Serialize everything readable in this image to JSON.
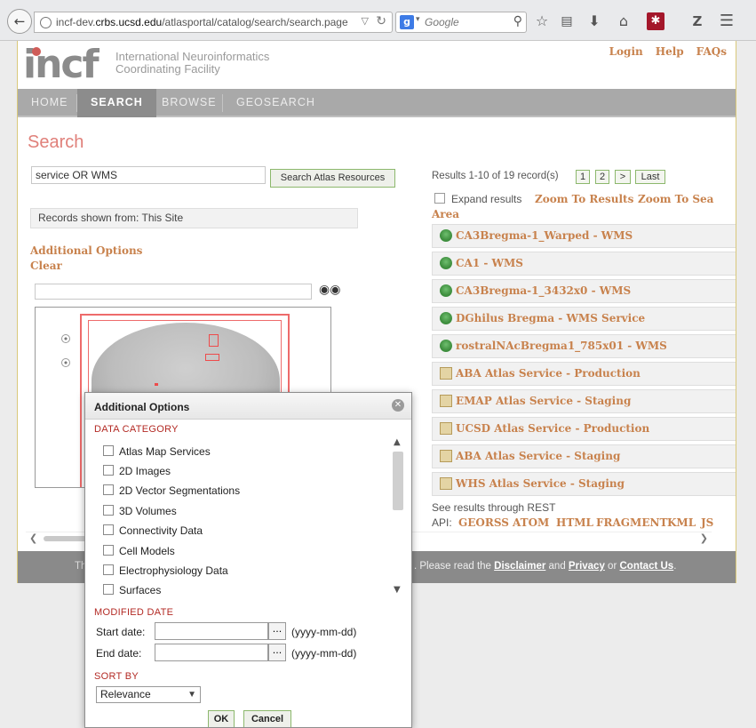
{
  "browser": {
    "url_prefix": "incf-dev.",
    "url_domain": "crbs.ucsd.edu",
    "url_path": "/atlasportal/catalog/search/search.page",
    "search_engine_letter": "g",
    "search_placeholder": "Google"
  },
  "header": {
    "logo_mark": "incf",
    "logo_line1": "International Neuroinformatics",
    "logo_line2": "Coordinating Facility",
    "links": [
      "Login",
      "Help",
      "FAQs"
    ]
  },
  "nav": {
    "items": [
      "HOME",
      "SEARCH",
      "BROWSE",
      "GEOSEARCH"
    ],
    "active": "SEARCH"
  },
  "main": {
    "title": "Search",
    "search_value": "service OR WMS",
    "search_button": "Search Atlas Resources",
    "records_from": "Records shown from: This Site",
    "additional_options": "Additional Options",
    "clear": "Clear"
  },
  "results": {
    "count_text": "Results 1-10 of 19 record(s)",
    "pages": [
      "1",
      "2",
      ">",
      "Last"
    ],
    "expand_label": "Expand results",
    "zoom_to_results": "Zoom To Results",
    "zoom_to_search": "Zoom To Sea",
    "area": "Area",
    "items": [
      {
        "label": "CA3Bregma-1_Warped - WMS",
        "icon": "wms-globe-icon"
      },
      {
        "label": "CA1 - WMS",
        "icon": "wms-globe-icon"
      },
      {
        "label": "CA3Bregma-1_3432x0 - WMS",
        "icon": "wms-globe-icon"
      },
      {
        "label": "DGhilus Bregma - WMS Service",
        "icon": "wms-globe-icon"
      },
      {
        "label": "rostralNAcBregma1_785x01 - WMS",
        "icon": "wms-globe-icon"
      },
      {
        "label": "ABA Atlas Service - Production",
        "icon": "atlas-service-icon"
      },
      {
        "label": "EMAP Atlas Service - Staging",
        "icon": "atlas-service-icon"
      },
      {
        "label": "UCSD Atlas Service - Production",
        "icon": "atlas-service-icon"
      },
      {
        "label": "ABA Atlas Service - Staging",
        "icon": "atlas-service-icon"
      },
      {
        "label": "WHS Atlas Service - Staging",
        "icon": "atlas-service-icon"
      }
    ],
    "rest_text": "See results through REST",
    "api_label": "API:",
    "api_links": [
      "GEORSS",
      "ATOM",
      "HTML",
      "FRAGMENT",
      "KML",
      "JS"
    ]
  },
  "footer": {
    "pre": "Th",
    "text_a": ". Please read the ",
    "disclaimer": "Disclaimer",
    "and": " and ",
    "privacy": "Privacy",
    "or": " or ",
    "contact": "Contact Us",
    "end": "."
  },
  "dialog": {
    "title": "Additional Options",
    "data_category": "DATA CATEGORY",
    "categories": [
      "Atlas Map Services",
      "2D Images",
      "2D Vector Segmentations",
      "3D Volumes",
      "Connectivity Data",
      "Cell Models",
      "Electrophysiology Data",
      "Surfaces"
    ],
    "modified_date": "MODIFIED DATE",
    "start_label": "Start date:",
    "end_label": "End date:",
    "date_button": "...",
    "date_format": "(yyyy-mm-dd)",
    "sort_by": "SORT BY",
    "sort_value": "Relevance",
    "ok": "OK",
    "cancel": "Cancel"
  },
  "colors": {
    "link": "#c8824d",
    "title": "#e0807a",
    "section_head": "#b32a24",
    "nav_bg": "#a9a9a9",
    "nav_active": "#8c8c8c",
    "button_border": "#8cb86c"
  }
}
